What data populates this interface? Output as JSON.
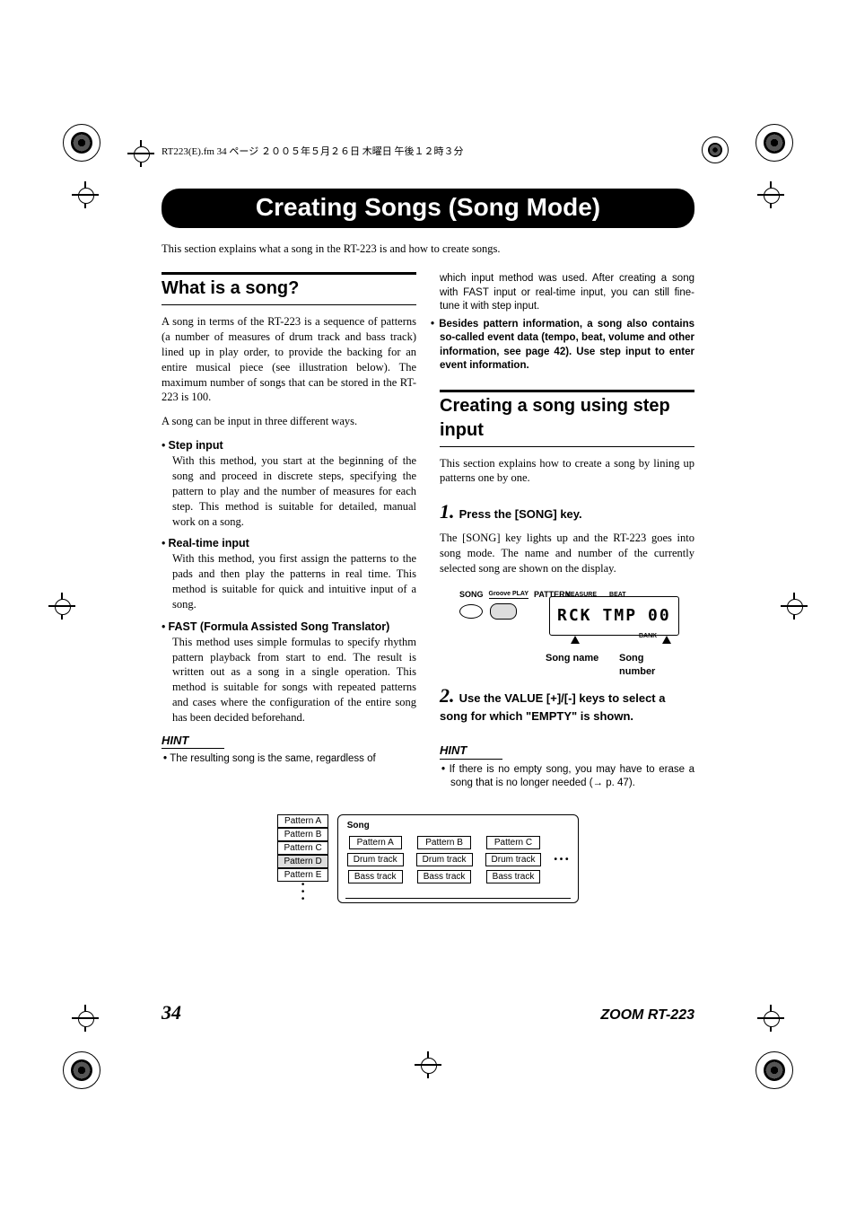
{
  "header_text": "RT223(E).fm 34 ページ ２００５年５月２６日 木曜日 午後１２時３分",
  "main_title": "Creating Songs (Song Mode)",
  "intro": "This section explains what a song in the RT-223 is and how to create songs.",
  "section1_title": "What is a song?",
  "section1_p1": "A song in terms of the RT-223 is a sequence of patterns (a number of measures of drum track and bass track) lined up in play order, to provide the backing for an entire musical piece (see illustration below). The maximum number of songs that can be stored in the RT-223 is 100.",
  "section1_p2": "A song can be input in three different ways.",
  "methods": [
    {
      "title": "Step input",
      "body": "With this method, you start at the beginning of the song and proceed in discrete steps, specifying the pattern to play and the number of measures for each step. This method is suitable for detailed, manual work on a song."
    },
    {
      "title": "Real-time input",
      "body": "With this method, you first assign the patterns to the pads and then play the patterns in real time. This method is suitable for quick and intuitive input of a song."
    },
    {
      "title": "FAST (Formula Assisted Song Translator)",
      "body": "This method uses simple formulas to specify rhythm pattern playback from start to end. The result is written out as a song in a single operation. This method is suitable for songs with repeated patterns and cases where the configuration of the entire song has been decided beforehand."
    }
  ],
  "hint1_label": "HINT",
  "hint1_items": [
    "The resulting song is the same, regardless of",
    "which input method was used. After creating a song with FAST input or real-time input, you can still fine-tune it with step input.",
    "Besides pattern information, a song also contains so-called event data (tempo, beat, volume and other information, see page 42). Use step input to enter event information."
  ],
  "section2_title": "Creating a song using step input",
  "section2_intro": "This section explains how to create a song by lining up patterns one by one.",
  "step1": {
    "num": "1.",
    "title": "Press the [SONG] key.",
    "body": "The [SONG] key lights up and the RT-223 goes into song mode. The name and number of the currently selected song are shown on the display."
  },
  "display": {
    "label_song": "SONG",
    "label_groove": "Groove PLAY",
    "label_pattern": "PATTERN",
    "label_measure": "MEASURE",
    "label_beat": "BEAT",
    "label_bank": "BANK",
    "lcd_left": "RCK",
    "lcd_mid": "TMP",
    "lcd_right": "00",
    "caption_name": "Song name",
    "caption_number": "Song number"
  },
  "step2": {
    "num": "2.",
    "title": "Use the VALUE [+]/[-] keys to select a song for which \"EMPTY\" is shown."
  },
  "hint2_label": "HINT",
  "hint2_items": [
    "If there is no empty song, you may have to erase a song that is no longer needed (→ p. 47)."
  ],
  "diagram": {
    "patterns": [
      "Pattern A",
      "Pattern B",
      "Pattern C",
      "Pattern D",
      "Pattern E"
    ],
    "song_label": "Song",
    "song_patterns": [
      "Pattern A",
      "Pattern B",
      "Pattern C"
    ],
    "drum_label": "Drum track",
    "bass_label": "Bass track"
  },
  "page_number": "34",
  "model": "ZOOM RT-223"
}
